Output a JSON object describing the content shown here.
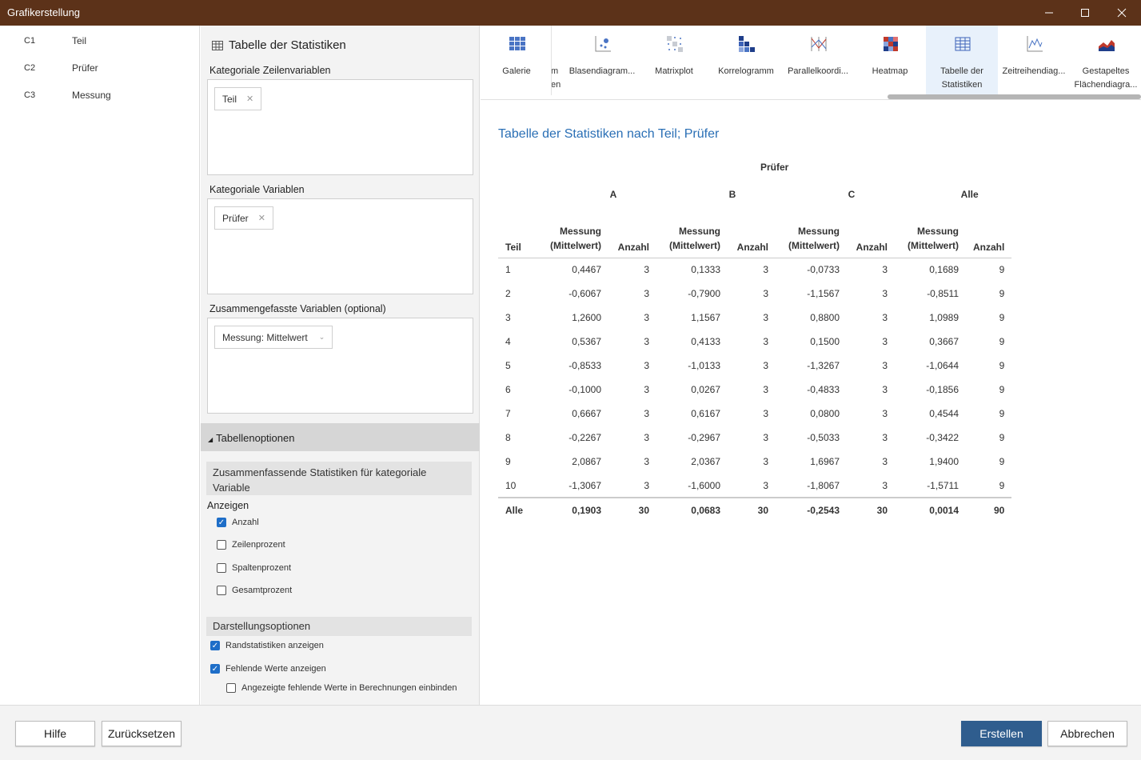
{
  "window": {
    "title": "Grafikerstellung"
  },
  "variables": [
    {
      "id": "C1",
      "name": "Teil"
    },
    {
      "id": "C2",
      "name": "Prüfer"
    },
    {
      "id": "C3",
      "name": "Messung"
    }
  ],
  "dialog": {
    "title": "Tabelle der Statistiken",
    "row_vars_label": "Kategoriale Zeilenvariablen",
    "row_vars_chip": "Teil",
    "cat_vars_label": "Kategoriale Variablen",
    "cat_vars_chip": "Prüfer",
    "summary_vars_label": "Zusammengefasste Variablen (optional)",
    "summary_vars_chip": "Messung: Mittelwert",
    "table_options_label": "Tabellenoptionen",
    "summary_stats_header": "Zusammenfassende Statistiken für kategoriale Variable",
    "show_label": "Anzeigen",
    "checkboxes": [
      {
        "label": "Anzahl",
        "checked": true
      },
      {
        "label": "Zeilenprozent",
        "checked": false
      },
      {
        "label": "Spaltenprozent",
        "checked": false
      },
      {
        "label": "Gesamtprozent",
        "checked": false
      }
    ],
    "display_options_header": "Darstellungsoptionen",
    "display_checkboxes": [
      {
        "label": "Randstatistiken anzeigen",
        "checked": true
      },
      {
        "label": "Fehlende Werte anzeigen",
        "checked": true
      },
      {
        "label": "Angezeigte fehlende Werte in Berechnungen einbinden",
        "checked": false
      }
    ]
  },
  "gallery": [
    {
      "label": "Galerie",
      "icon": "gallery-icon",
      "selected": false
    },
    {
      "label": "m\nen",
      "icon": "partial-icon",
      "selected": false
    },
    {
      "label": "Blasendiagram...",
      "icon": "bubble-chart-icon",
      "selected": false
    },
    {
      "label": "Matrixplot",
      "icon": "matrix-plot-icon",
      "selected": false
    },
    {
      "label": "Korrelogramm",
      "icon": "correlogram-icon",
      "selected": false
    },
    {
      "label": "Parallelkoordi...",
      "icon": "parallel-coordinates-icon",
      "selected": false
    },
    {
      "label": "Heatmap",
      "icon": "heatmap-icon",
      "selected": false
    },
    {
      "label": "Tabelle der\nStatistiken",
      "icon": "statistics-table-icon",
      "selected": true
    },
    {
      "label": "Zeitreihendiag...",
      "icon": "time-series-icon",
      "selected": false
    },
    {
      "label": "Gestapeltes\nFlächendiagra...",
      "icon": "stacked-area-icon",
      "selected": false
    }
  ],
  "output": {
    "title": "Tabelle der Statistiken nach Teil; Prüfer",
    "group_header": "Prüfer",
    "groups": [
      "A",
      "B",
      "C",
      "Alle"
    ],
    "row_header": "Teil",
    "col_mean_line1": "Messung",
    "col_mean_line2": "(Mittelwert)",
    "col_count": "Anzahl",
    "rows": [
      {
        "teil": "1",
        "vals": [
          "0,4467",
          "3",
          "0,1333",
          "3",
          "-0,0733",
          "3",
          "0,1689",
          "9"
        ]
      },
      {
        "teil": "2",
        "vals": [
          "-0,6067",
          "3",
          "-0,7900",
          "3",
          "-1,1567",
          "3",
          "-0,8511",
          "9"
        ]
      },
      {
        "teil": "3",
        "vals": [
          "1,2600",
          "3",
          "1,1567",
          "3",
          "0,8800",
          "3",
          "1,0989",
          "9"
        ]
      },
      {
        "teil": "4",
        "vals": [
          "0,5367",
          "3",
          "0,4133",
          "3",
          "0,1500",
          "3",
          "0,3667",
          "9"
        ]
      },
      {
        "teil": "5",
        "vals": [
          "-0,8533",
          "3",
          "-1,0133",
          "3",
          "-1,3267",
          "3",
          "-1,0644",
          "9"
        ]
      },
      {
        "teil": "6",
        "vals": [
          "-0,1000",
          "3",
          "0,0267",
          "3",
          "-0,4833",
          "3",
          "-0,1856",
          "9"
        ]
      },
      {
        "teil": "7",
        "vals": [
          "0,6667",
          "3",
          "0,6167",
          "3",
          "0,0800",
          "3",
          "0,4544",
          "9"
        ]
      },
      {
        "teil": "8",
        "vals": [
          "-0,2267",
          "3",
          "-0,2967",
          "3",
          "-0,5033",
          "3",
          "-0,3422",
          "9"
        ]
      },
      {
        "teil": "9",
        "vals": [
          "2,0867",
          "3",
          "2,0367",
          "3",
          "1,6967",
          "3",
          "1,9400",
          "9"
        ]
      },
      {
        "teil": "10",
        "vals": [
          "-1,3067",
          "3",
          "-1,6000",
          "3",
          "-1,8067",
          "3",
          "-1,5711",
          "9"
        ]
      }
    ],
    "total_row": {
      "teil": "Alle",
      "vals": [
        "0,1903",
        "30",
        "0,0683",
        "30",
        "-0,2543",
        "30",
        "0,0014",
        "90"
      ]
    }
  },
  "footer": {
    "help": "Hilfe",
    "reset": "Zurücksetzen",
    "create": "Erstellen",
    "cancel": "Abbrechen"
  },
  "colors": {
    "titlebar": "#5c3219",
    "accent": "#2a6fb5",
    "primary_button": "#2f5d8e"
  }
}
